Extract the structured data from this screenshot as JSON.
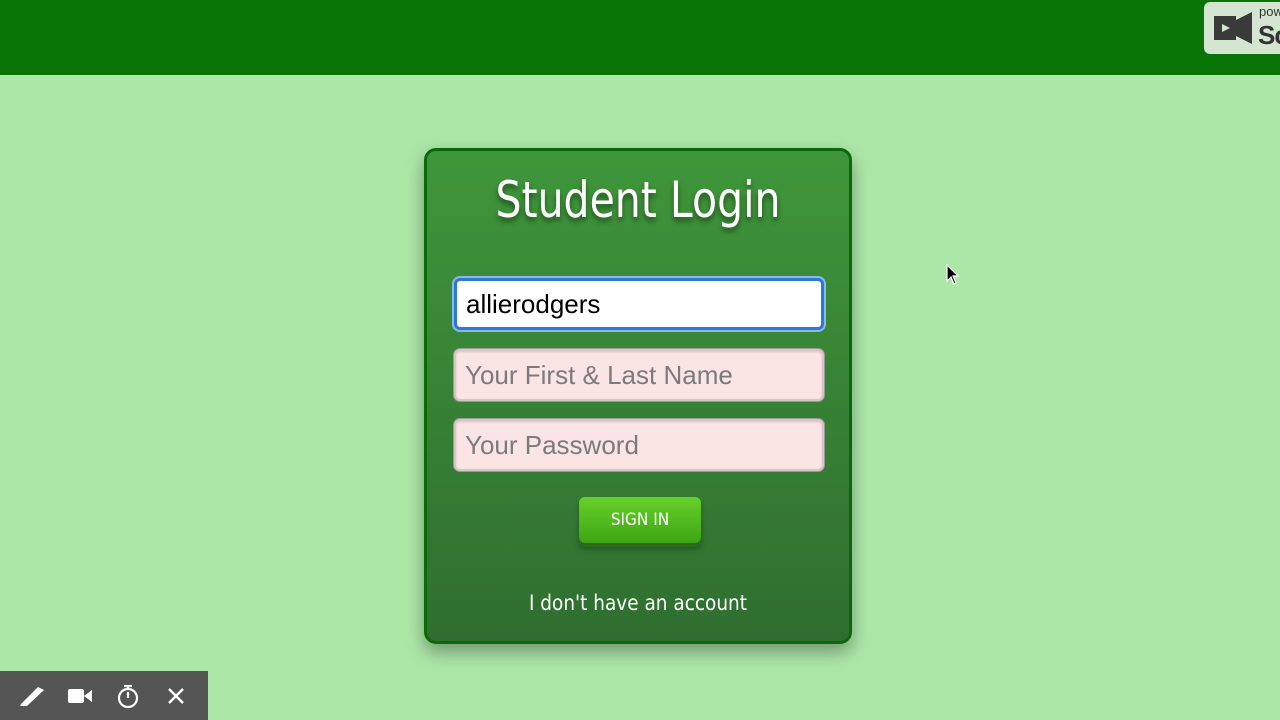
{
  "header": {
    "watermark_small_text": "pow",
    "watermark_big_text": "Sc"
  },
  "login": {
    "title": "Student Login",
    "username_value": "allierodgers",
    "name_placeholder": "Your First & Last Name",
    "password_placeholder": "Your Password",
    "signin_label": "SIGN IN",
    "no_account_link": "I don't have an account"
  },
  "toolbar": {
    "items": [
      "pen-icon",
      "camera-icon",
      "timer-icon",
      "close-icon"
    ]
  },
  "colors": {
    "page_background": "#ade7a8",
    "top_bar": "#087406",
    "card": "#3a8a36",
    "button": "#52bb1f",
    "input_bg": "#fbe4e4",
    "focus_border": "#2f79d6"
  }
}
